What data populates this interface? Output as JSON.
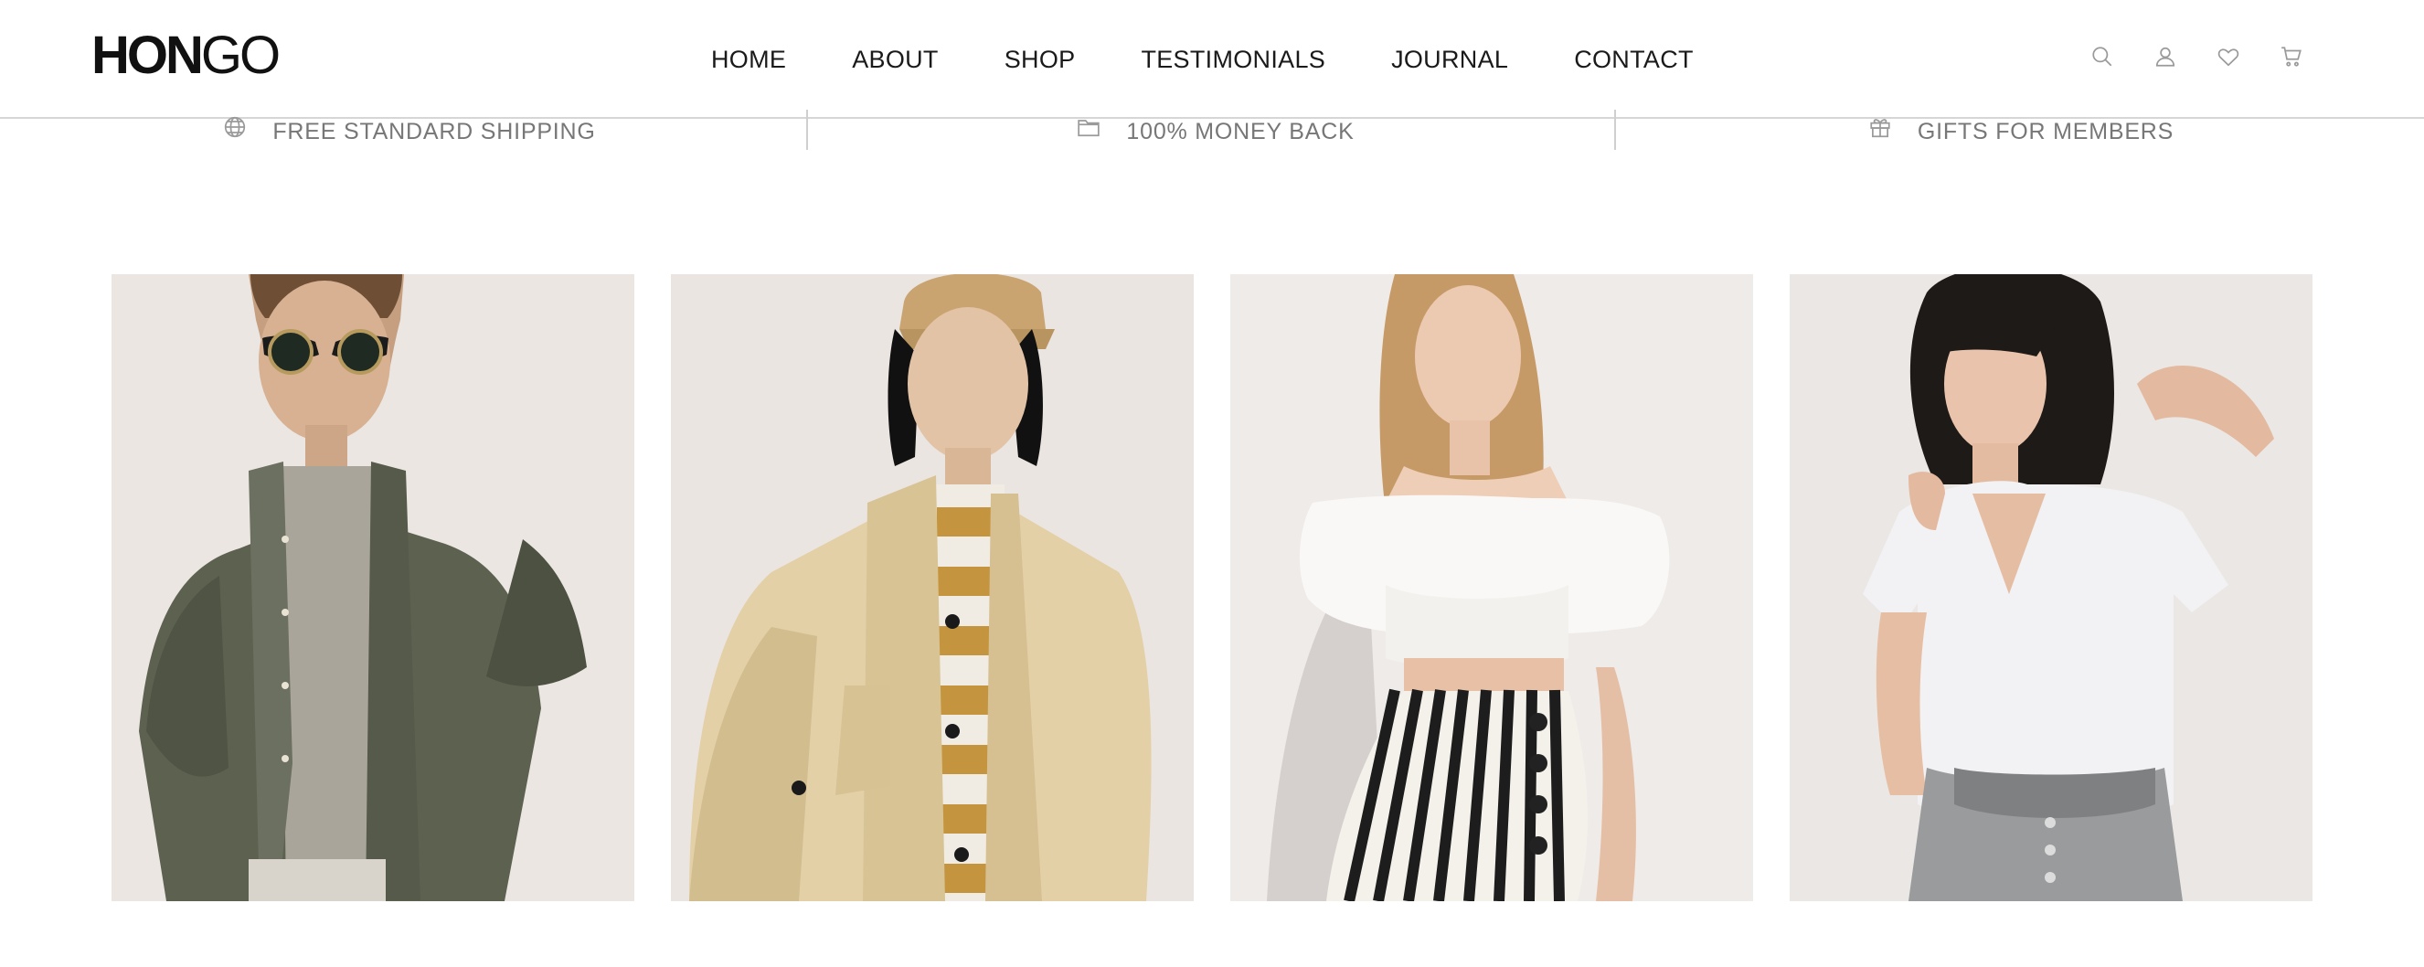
{
  "brand": {
    "logo_bold": "HON",
    "logo_light": "GO"
  },
  "nav": {
    "items": [
      {
        "label": "HOME"
      },
      {
        "label": "ABOUT"
      },
      {
        "label": "SHOP"
      },
      {
        "label": "TESTIMONIALS"
      },
      {
        "label": "JOURNAL"
      },
      {
        "label": "CONTACT"
      }
    ]
  },
  "tools": {
    "icons": [
      "search-icon",
      "user-icon",
      "heart-icon",
      "cart-icon"
    ]
  },
  "features": [
    {
      "icon": "globe-icon",
      "label": "FREE STANDARD SHIPPING"
    },
    {
      "icon": "folder-icon",
      "label": "100% MONEY BACK"
    },
    {
      "icon": "gift-icon",
      "label": "GIFTS FOR MEMBERS"
    }
  ],
  "products": [
    {
      "image": "man-in-olive-short-sleeve-shirt-and-sunglasses"
    },
    {
      "image": "man-in-beige-cap-and-trench-coat-over-striped-tee"
    },
    {
      "image": "woman-in-white-off-shoulder-top-and-striped-trousers"
    },
    {
      "image": "woman-in-white-v-neck-tee-and-grey-jeans"
    }
  ],
  "colors": {
    "nav_text": "#1a1a1a",
    "muted": "#777777",
    "icon": "#9a9a9a",
    "divider": "#d6d6d6",
    "photo_bg": "#ebe6e2"
  }
}
